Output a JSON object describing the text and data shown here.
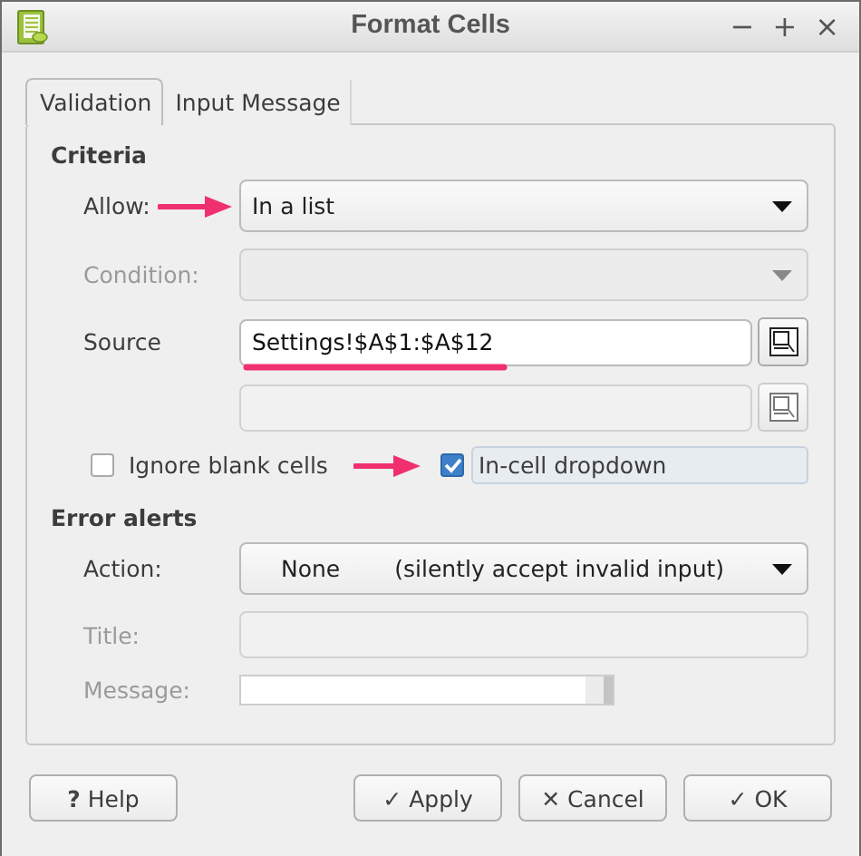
{
  "window": {
    "title": "Format Cells",
    "controls": [
      "−",
      "+",
      "×"
    ]
  },
  "tabs": [
    {
      "label": "Validation",
      "selected": true
    },
    {
      "label": "Input Message",
      "selected": false
    }
  ],
  "criteria": {
    "heading": "Criteria",
    "allow": {
      "label": "Allow:",
      "value": "In a list",
      "arrow_marked": true
    },
    "condition": {
      "label": "Condition:",
      "disabled": true
    },
    "source": {
      "label": "Source",
      "value": "Settings!$A$1:$A$12",
      "underlined": true
    },
    "source_2": {
      "disabled": true
    },
    "checkboxes": [
      {
        "label": "Ignore blank cells",
        "checked": false,
        "arrow_marked": false,
        "focused": false
      },
      {
        "label": "In-cell dropdown",
        "checked": true,
        "arrow_marked": true,
        "focused": true
      }
    ]
  },
  "error_alerts": {
    "heading": "Error alerts",
    "action": {
      "label": "Action:",
      "value": "None",
      "note": "(silently accept invalid input)"
    },
    "title": {
      "label": "Title:",
      "disabled": true
    },
    "message": {
      "label": "Message:",
      "disabled": true
    }
  },
  "buttons": [
    {
      "label": "Help",
      "icon": "?",
      "kind": "help"
    },
    {
      "label": "Apply",
      "icon": "✓",
      "kind": "action"
    },
    {
      "label": "Cancel",
      "icon": "✕",
      "kind": "action"
    },
    {
      "label": "OK",
      "icon": "✓",
      "kind": "action"
    }
  ]
}
